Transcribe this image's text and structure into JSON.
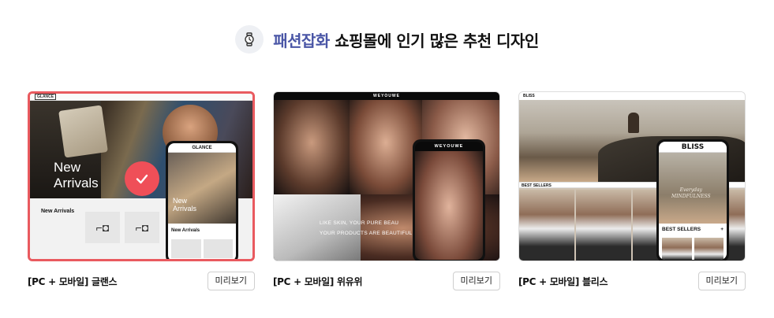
{
  "heading": {
    "accent": "패션잡화",
    "rest": " 쇼핑몰에 인기 많은 추천 디자인",
    "icon": "watch-icon",
    "accent_color": "#4a56a6"
  },
  "templates": [
    {
      "title": "[PC + 모바일] 글랜스",
      "preview_label": "미리보기",
      "selected": true,
      "thumb": {
        "brand": "GLANCE",
        "hero_text_line1": "New",
        "hero_text_line2": "Arrivals",
        "section_label": "New Arrivals",
        "phone_section_label": "New Arrivals"
      }
    },
    {
      "title": "[PC + 모바일] 위유위",
      "preview_label": "미리보기",
      "selected": false,
      "thumb": {
        "brand": "WEYOUWE",
        "slogan_line1": "LIKE SKIN, YOUR PURE BEAU",
        "slogan_line2": "YOUR PRODUCTS ARE BEAUTIFUL, ALWAY FOR PU"
      }
    },
    {
      "title": "[PC + 모바일] 블리스",
      "preview_label": "미리보기",
      "selected": false,
      "thumb": {
        "brand": "BLISS",
        "section_label": "BEST SELLERS",
        "phone_script_line1": "Everyday",
        "phone_script_line2": "MINDFULNESS"
      }
    }
  ],
  "colors": {
    "selected_border": "#e95a5f",
    "check_badge": "#ef4f58"
  }
}
